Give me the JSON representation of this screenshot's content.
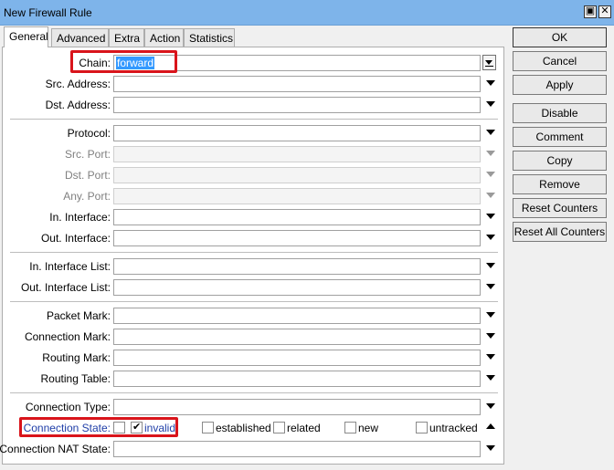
{
  "window": {
    "title": "New Firewall Rule",
    "restore_glyph": "▣",
    "close_glyph": "✕"
  },
  "tabs": [
    "General",
    "Advanced",
    "Extra",
    "Action",
    "Statistics"
  ],
  "fields": {
    "chain": {
      "label": "Chain:",
      "value": "forward"
    },
    "src_address": {
      "label": "Src. Address:"
    },
    "dst_address": {
      "label": "Dst. Address:"
    },
    "protocol": {
      "label": "Protocol:"
    },
    "src_port": {
      "label": "Src. Port:"
    },
    "dst_port": {
      "label": "Dst. Port:"
    },
    "any_port": {
      "label": "Any. Port:"
    },
    "in_interface": {
      "label": "In. Interface:"
    },
    "out_interface": {
      "label": "Out. Interface:"
    },
    "in_interface_list": {
      "label": "In. Interface List:"
    },
    "out_interface_list": {
      "label": "Out. Interface List:"
    },
    "packet_mark": {
      "label": "Packet Mark:"
    },
    "connection_mark": {
      "label": "Connection Mark:"
    },
    "routing_mark": {
      "label": "Routing Mark:"
    },
    "routing_table": {
      "label": "Routing Table:"
    },
    "connection_type": {
      "label": "Connection Type:"
    },
    "connection_nat_state": {
      "label": "Connection NAT State:"
    }
  },
  "connection_state": {
    "label": "Connection State:",
    "options": [
      {
        "label": "invalid",
        "checked": true
      },
      {
        "label": "established",
        "checked": false
      },
      {
        "label": "related",
        "checked": false
      },
      {
        "label": "new",
        "checked": false
      },
      {
        "label": "untracked",
        "checked": false
      }
    ]
  },
  "buttons": {
    "ok": "OK",
    "cancel": "Cancel",
    "apply": "Apply",
    "disable": "Disable",
    "comment": "Comment",
    "copy": "Copy",
    "remove": "Remove",
    "reset_counters": "Reset Counters",
    "reset_all_counters": "Reset All Counters"
  },
  "colors": {
    "titlebar": "#7eb4ea",
    "highlight": "#d9141b",
    "selection": "#3399ff",
    "link_label": "#1f3ea8"
  }
}
